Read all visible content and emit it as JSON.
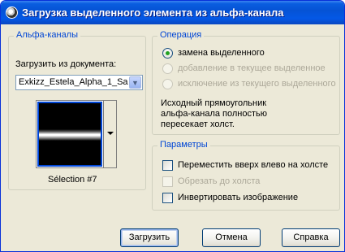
{
  "window": {
    "title": "Загрузка выделенного элемента из альфа-канала"
  },
  "alpha_group": {
    "legend": "Альфа-каналы",
    "load_from_label": "Загрузить из документа:",
    "document_value": "Exkizz_Estela_Alpha_1_Sa",
    "selection_name": "Sélection #7"
  },
  "operation_group": {
    "legend": "Операция",
    "options": [
      {
        "label": "замена выделенного",
        "checked": true,
        "enabled": true
      },
      {
        "label": "добавление в текущее выделенное",
        "checked": false,
        "enabled": false
      },
      {
        "label": "исключение из текущего выделенного",
        "checked": false,
        "enabled": false
      }
    ],
    "note": [
      "Исходный прямоугольник",
      "альфа-канала полностью",
      "пересекает холст."
    ]
  },
  "params_group": {
    "legend": "Параметры",
    "options": [
      {
        "label": "Переместить вверх влево на холсте",
        "checked": false,
        "enabled": true
      },
      {
        "label": "Обрезать до холста",
        "checked": false,
        "enabled": false
      },
      {
        "label": "Инвертировать изображение",
        "checked": false,
        "enabled": true
      }
    ]
  },
  "buttons": {
    "load": "Загрузить",
    "cancel": "Отмена",
    "help": "Справка"
  }
}
